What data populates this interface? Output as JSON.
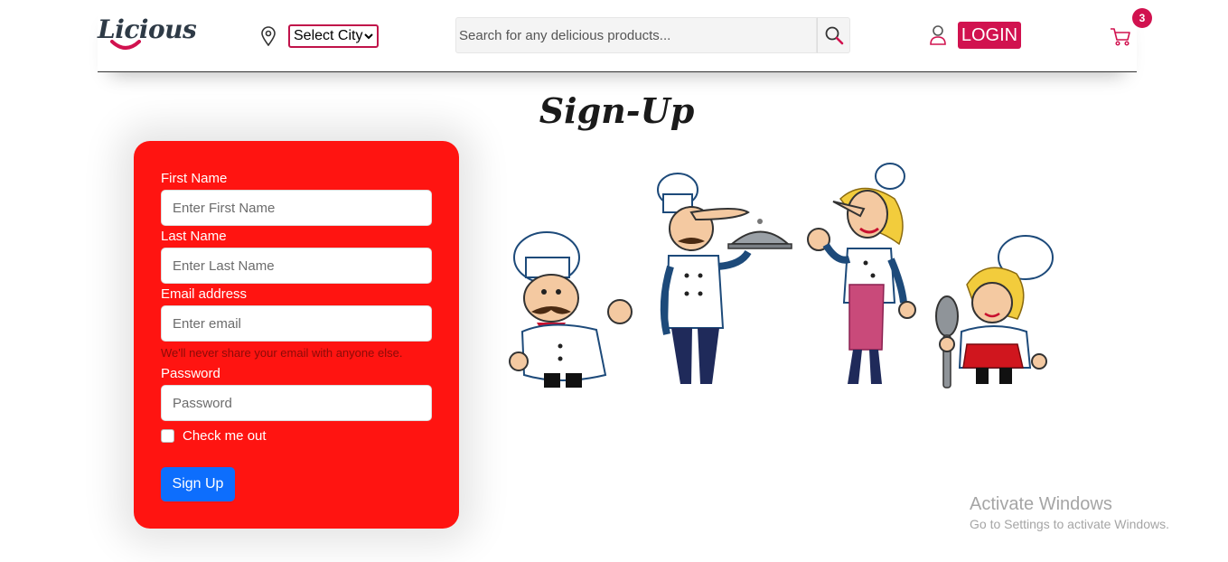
{
  "header": {
    "logo_text": "Licious",
    "city_select": {
      "selected": "Select City"
    },
    "search": {
      "placeholder": "Search for any delicious products..."
    },
    "login_label": "LOGIN",
    "cart_count": "3",
    "brand_color": "#d1124f"
  },
  "page_title": "Sign-Up",
  "form": {
    "card_color": "#ff1411",
    "first_name": {
      "label": "First Name",
      "placeholder": "Enter First Name"
    },
    "last_name": {
      "label": "Last Name",
      "placeholder": "Enter Last Name"
    },
    "email": {
      "label": "Email address",
      "placeholder": "Enter email",
      "help": "We'll never share your email with anyone else."
    },
    "password": {
      "label": "Password",
      "placeholder": "Password"
    },
    "checkbox_label": "Check me out",
    "submit_label": "Sign Up",
    "submit_color": "#0d6efd"
  },
  "illustration": {
    "subject": "four cartoon chefs"
  },
  "watermark": {
    "title": "Activate Windows",
    "subtitle": "Go to Settings to activate Windows."
  },
  "icons": [
    "location-pin-icon",
    "chevron-down-icon",
    "search-icon",
    "user-icon",
    "cart-icon",
    "checkbox-icon"
  ]
}
